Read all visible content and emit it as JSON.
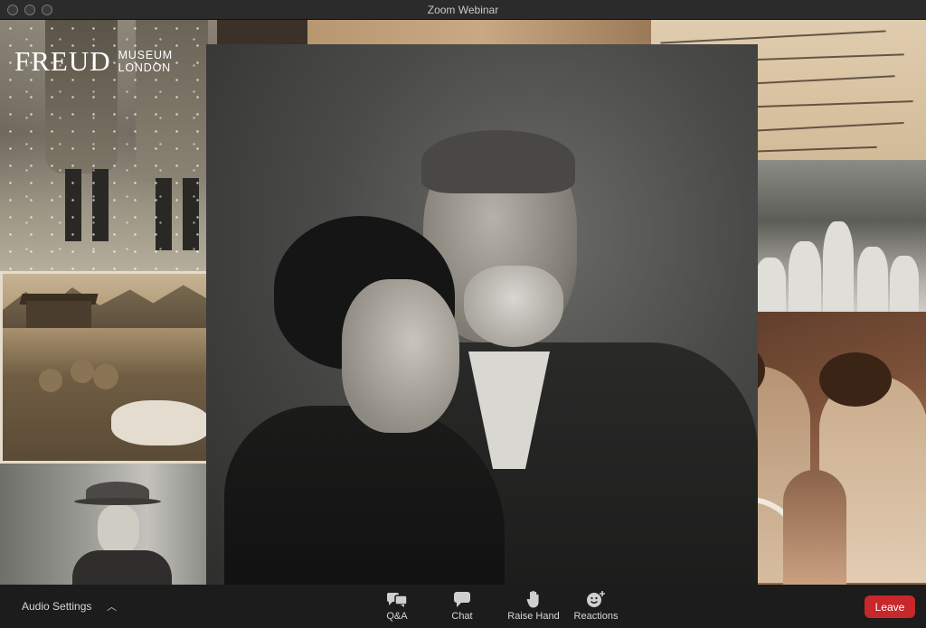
{
  "window": {
    "title": "Zoom Webinar"
  },
  "logo": {
    "name": "FREUD",
    "line1": "MUSEUM",
    "line2": "LONDON"
  },
  "toolbar": {
    "audio_settings": "Audio Settings",
    "qa": "Q&A",
    "chat": "Chat",
    "raise_hand": "Raise Hand",
    "reactions": "Reactions",
    "leave": "Leave"
  },
  "colors": {
    "leave_button": "#c8272b",
    "toolbar_bg": "#1c1c1c",
    "titlebar_bg": "#2b2b2b"
  },
  "icons": [
    "chevron-up-icon",
    "qa-icon",
    "chat-icon",
    "raise-hand-icon",
    "reactions-icon"
  ]
}
